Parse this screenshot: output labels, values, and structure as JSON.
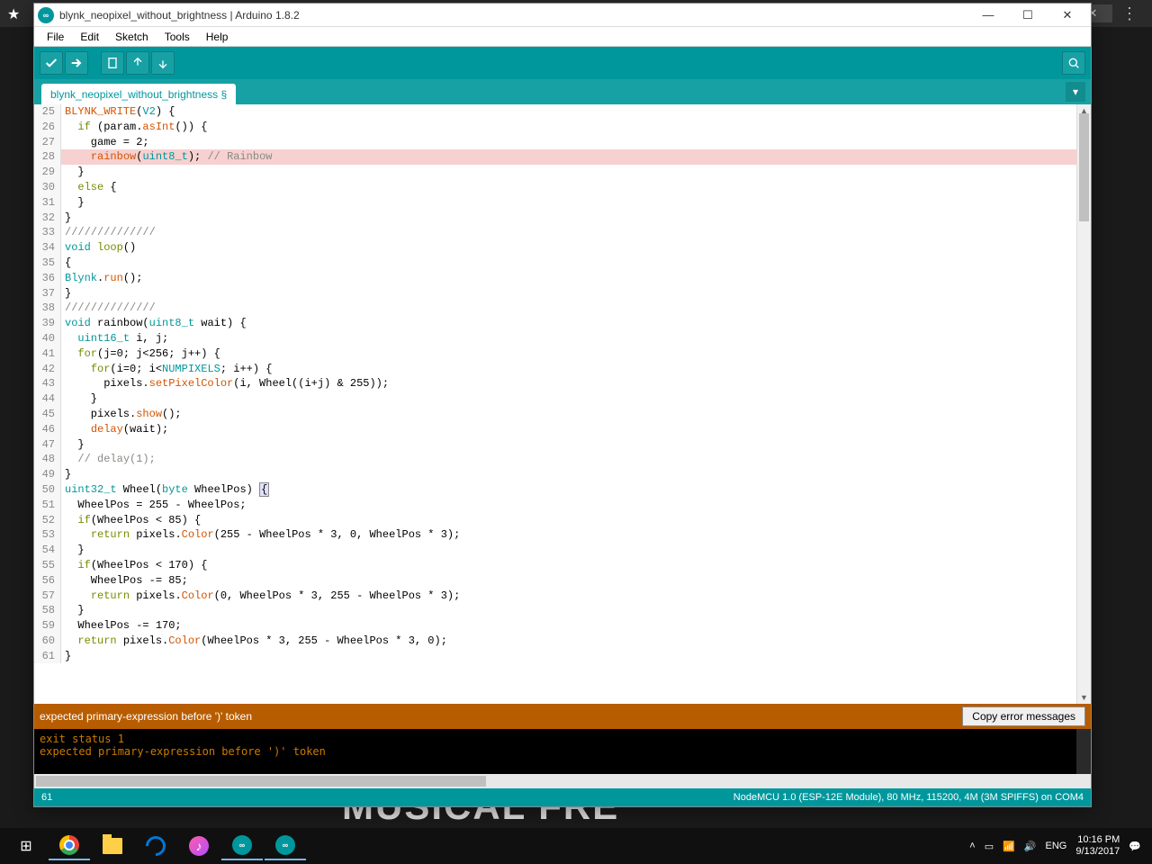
{
  "browser": {
    "star": "★"
  },
  "window": {
    "title": "blynk_neopixel_without_brightness | Arduino 1.8.2",
    "icon_text": "∞"
  },
  "menu": {
    "file": "File",
    "edit": "Edit",
    "sketch": "Sketch",
    "tools": "Tools",
    "help": "Help"
  },
  "tab": {
    "name": "blynk_neopixel_without_brightness §"
  },
  "code_lines": [
    {
      "n": "",
      "html": ""
    },
    {
      "n": "25",
      "html": "<span class='k-func'>BLYNK_WRITE</span>(<span class='k-type'>V2</span>) {"
    },
    {
      "n": "26",
      "html": "  <span class='k-kw'>if</span> (param.<span class='k-func'>asInt</span>()) {"
    },
    {
      "n": "27",
      "html": "    game = 2;"
    },
    {
      "n": "28",
      "html": "    <span class='k-func'>rainbow</span>(<span class='k-type'>uint8_t</span>); <span class='k-com'>// Rainbow</span>",
      "err": true
    },
    {
      "n": "29",
      "html": "  }"
    },
    {
      "n": "30",
      "html": "  <span class='k-kw'>else</span> {"
    },
    {
      "n": "31",
      "html": "  }"
    },
    {
      "n": "32",
      "html": "}"
    },
    {
      "n": "33",
      "html": "<span class='k-com'>//////////////</span>"
    },
    {
      "n": "34",
      "html": "<span class='k-type'>void</span> <span class='k-kw'>loop</span>()"
    },
    {
      "n": "35",
      "html": "{"
    },
    {
      "n": "36",
      "html": "<span class='k-type'>Blynk</span>.<span class='k-func'>run</span>();"
    },
    {
      "n": "37",
      "html": "}"
    },
    {
      "n": "38",
      "html": "<span class='k-com'>//////////////</span>"
    },
    {
      "n": "39",
      "html": "<span class='k-type'>void</span> rainbow(<span class='k-type'>uint8_t</span> wait) {"
    },
    {
      "n": "40",
      "html": "  <span class='k-type'>uint16_t</span> i, j;"
    },
    {
      "n": "41",
      "html": "  <span class='k-kw'>for</span>(j=0; j&lt;256; j++) {"
    },
    {
      "n": "42",
      "html": "    <span class='k-kw'>for</span>(i=0; i&lt;<span class='k-type'>NUMPIXELS</span>; i++) {"
    },
    {
      "n": "43",
      "html": "      pixels.<span class='k-func'>setPixelColor</span>(i, Wheel((i+j) &amp; 255));"
    },
    {
      "n": "44",
      "html": "    }"
    },
    {
      "n": "45",
      "html": "    pixels.<span class='k-func'>show</span>();"
    },
    {
      "n": "46",
      "html": "    <span class='k-func'>delay</span>(wait);"
    },
    {
      "n": "47",
      "html": "  }"
    },
    {
      "n": "48",
      "html": "  <span class='k-com'>// delay(1);</span>"
    },
    {
      "n": "49",
      "html": "}"
    },
    {
      "n": "50",
      "html": "<span class='k-type'>uint32_t</span> Wheel(<span class='k-type'>byte</span> WheelPos) <span class='bracket-hl'>{</span>"
    },
    {
      "n": "51",
      "html": "  WheelPos = 255 - WheelPos;"
    },
    {
      "n": "52",
      "html": "  <span class='k-kw'>if</span>(WheelPos &lt; 85) {"
    },
    {
      "n": "53",
      "html": "    <span class='k-kw'>return</span> pixels.<span class='k-func'>Color</span>(255 - WheelPos * 3, 0, WheelPos * 3);"
    },
    {
      "n": "54",
      "html": "  }"
    },
    {
      "n": "55",
      "html": "  <span class='k-kw'>if</span>(WheelPos &lt; 170) {"
    },
    {
      "n": "56",
      "html": "    WheelPos -= 85;"
    },
    {
      "n": "57",
      "html": "    <span class='k-kw'>return</span> pixels.<span class='k-func'>Color</span>(0, WheelPos * 3, 255 - WheelPos * 3);"
    },
    {
      "n": "58",
      "html": "  }"
    },
    {
      "n": "59",
      "html": "  WheelPos -= 170;"
    },
    {
      "n": "60",
      "html": "  <span class='k-kw'>return</span> pixels.<span class='k-func'>Color</span>(WheelPos * 3, 255 - WheelPos * 3, 0);"
    },
    {
      "n": "61",
      "html": "}"
    }
  ],
  "error_bar": {
    "message": "expected primary-expression before ')' token",
    "copy_label": "Copy error messages"
  },
  "console": {
    "line1": "exit status 1",
    "line2": "expected primary-expression before ')' token"
  },
  "statusbar": {
    "line_no": "61",
    "board": "NodeMCU 1.0 (ESP-12E Module), 80 MHz, 115200, 4M (3M SPIFFS) on COM4"
  },
  "taskbar": {
    "lang": "ENG",
    "time": "10:16 PM",
    "date": "9/13/2017"
  },
  "bg_text": "MUSICAL FRE"
}
